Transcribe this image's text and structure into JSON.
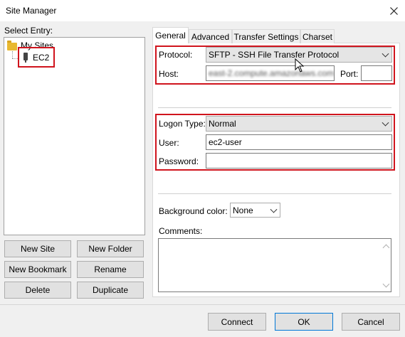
{
  "window": {
    "title": "Site Manager"
  },
  "left": {
    "select_entry_label": "Select Entry:",
    "tree": {
      "folder": "My Sites",
      "site": "EC2"
    },
    "buttons": {
      "new_site": "New Site",
      "new_folder": "New Folder",
      "new_bookmark": "New Bookmark",
      "rename": "Rename",
      "delete": "Delete",
      "duplicate": "Duplicate"
    }
  },
  "tabs": [
    "General",
    "Advanced",
    "Transfer Settings",
    "Charset"
  ],
  "general": {
    "protocol_label": "Protocol:",
    "protocol_value": "SFTP - SSH File Transfer Protocol",
    "host_label": "Host:",
    "host_value": "east-2.compute.amazonaws.com",
    "port_label": "Port:",
    "port_value": "",
    "logon_type_label": "Logon Type:",
    "logon_type_value": "Normal",
    "user_label": "User:",
    "user_value": "ec2-user",
    "password_label": "Password:",
    "password_value": "",
    "bg_color_label": "Background color:",
    "bg_color_value": "None",
    "comments_label": "Comments:",
    "comments_value": ""
  },
  "footer": {
    "connect": "Connect",
    "ok": "OK",
    "cancel": "Cancel"
  },
  "colors": {
    "highlight": "#d0141d",
    "folder": "#e8b830"
  }
}
